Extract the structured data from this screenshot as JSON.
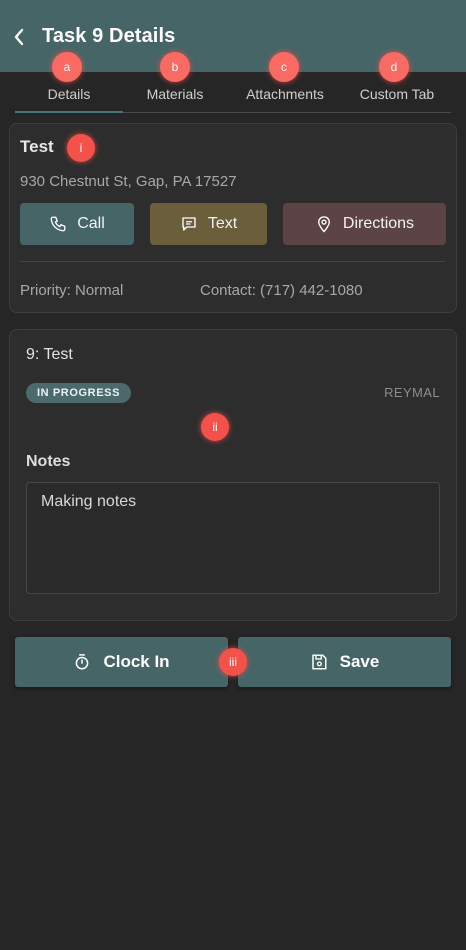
{
  "header": {
    "title": "Task 9 Details",
    "back_icon": "chevron-left-icon"
  },
  "tabs": [
    {
      "label": "Details",
      "marker": "a",
      "active": true
    },
    {
      "label": "Materials",
      "marker": "b",
      "active": false
    },
    {
      "label": "Attachments",
      "marker": "c",
      "active": false
    },
    {
      "label": "Custom Tab",
      "marker": "d",
      "active": false
    }
  ],
  "location": {
    "name": "Test",
    "marker": "i",
    "address": "930 Chestnut St, Gap, PA 17527",
    "priority": "Priority: Normal",
    "contact": "Contact: (717) 442-1080"
  },
  "actions": [
    {
      "label": "Call",
      "icon": "phone-icon",
      "color": "#466567"
    },
    {
      "label": "Text",
      "icon": "message-icon",
      "color": "#6b5e3b"
    },
    {
      "label": "Directions",
      "icon": "map-pin-icon",
      "color": "#5c4446"
    }
  ],
  "task": {
    "title": "9:  Test",
    "status": "IN PROGRESS",
    "assignee": "REYMAL",
    "marker": "ii",
    "notes_label": "Notes",
    "notes_value": "Making notes"
  },
  "footer": {
    "clock_in": "Clock In",
    "save": "Save",
    "marker": "iii",
    "button_color": "#466567"
  },
  "colors": {
    "background": "#262626",
    "header": "#466567",
    "marker": "#f4514a"
  }
}
